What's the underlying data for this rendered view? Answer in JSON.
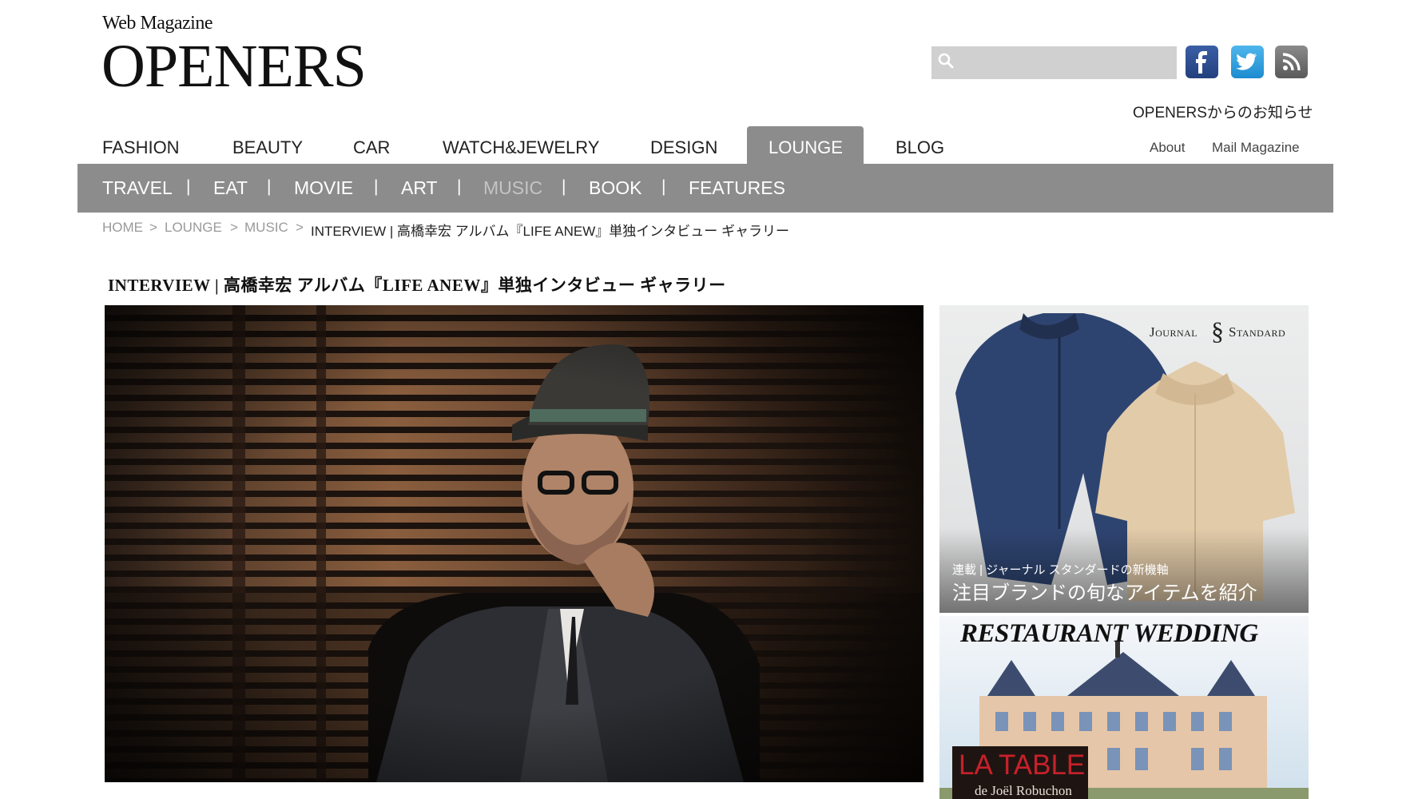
{
  "logo": {
    "top": "Web Magazine",
    "main": "OPENERS"
  },
  "search": {
    "placeholder": ""
  },
  "social": {
    "facebook": "facebook-icon",
    "twitter": "twitter-icon",
    "rss": "rss-icon"
  },
  "notice_link": "OPENERSからのお知らせ",
  "main_nav": {
    "items": [
      "FASHION",
      "BEAUTY",
      "CAR",
      "WATCH&JEWELRY",
      "DESIGN",
      "LOUNGE",
      "BLOG"
    ],
    "active": "LOUNGE"
  },
  "utility_nav": {
    "about": "About",
    "mail_magazine": "Mail Magazine"
  },
  "sub_nav": {
    "items": [
      "TRAVEL",
      "EAT",
      "MOVIE",
      "ART",
      "MUSIC",
      "BOOK",
      "FEATURES"
    ],
    "separator": "|",
    "active": "MUSIC"
  },
  "breadcrumb": {
    "items": [
      "HOME",
      "LOUNGE",
      "MUSIC"
    ],
    "separator": ">",
    "current": "INTERVIEW | 高橋幸宏 アルバム『LIFE ANEW』単独インタビュー ギャラリー"
  },
  "article": {
    "title": "INTERVIEW | 高橋幸宏 アルバム『LIFE ANEW』単独インタビュー ギャラリー"
  },
  "ads": {
    "journal_standard": {
      "brand_left": "Journal",
      "brand_right": "Standard",
      "caption_small": "連載 | ジャーナル スタンダードの新機軸",
      "caption_large": "注目ブランドの旬なアイテムを紹介"
    },
    "restaurant_wedding": {
      "headline": "RESTAURANT WEDDING",
      "logo_main": "LA TABLE",
      "logo_sub": "de Joël Robuchon"
    }
  },
  "colors": {
    "nav_gray": "#8c8c8c",
    "facebook": "#3b5998",
    "twitter": "#1da1f2",
    "rss": "#6b6b6b",
    "ad_red": "#c8202a"
  }
}
